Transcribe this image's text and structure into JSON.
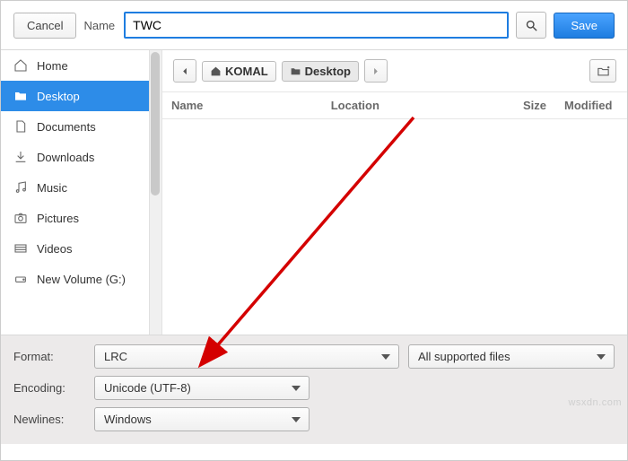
{
  "topbar": {
    "cancel": "Cancel",
    "name_label": "Name",
    "name_value": "TWC",
    "save": "Save"
  },
  "sidebar": {
    "items": [
      {
        "label": "Home"
      },
      {
        "label": "Desktop"
      },
      {
        "label": "Documents"
      },
      {
        "label": "Downloads"
      },
      {
        "label": "Music"
      },
      {
        "label": "Pictures"
      },
      {
        "label": "Videos"
      },
      {
        "label": "New Volume (G:)"
      }
    ],
    "selected_index": 1
  },
  "path": {
    "crumb1": "KOMAL",
    "crumb2": "Desktop"
  },
  "columns": {
    "name": "Name",
    "location": "Location",
    "size": "Size",
    "modified": "Modified"
  },
  "options": {
    "format_label": "Format:",
    "format_value": "LRC",
    "filter_value": "All supported files",
    "encoding_label": "Encoding:",
    "encoding_value": "Unicode (UTF-8)",
    "newlines_label": "Newlines:",
    "newlines_value": "Windows"
  },
  "watermark": "wsxdn.com"
}
